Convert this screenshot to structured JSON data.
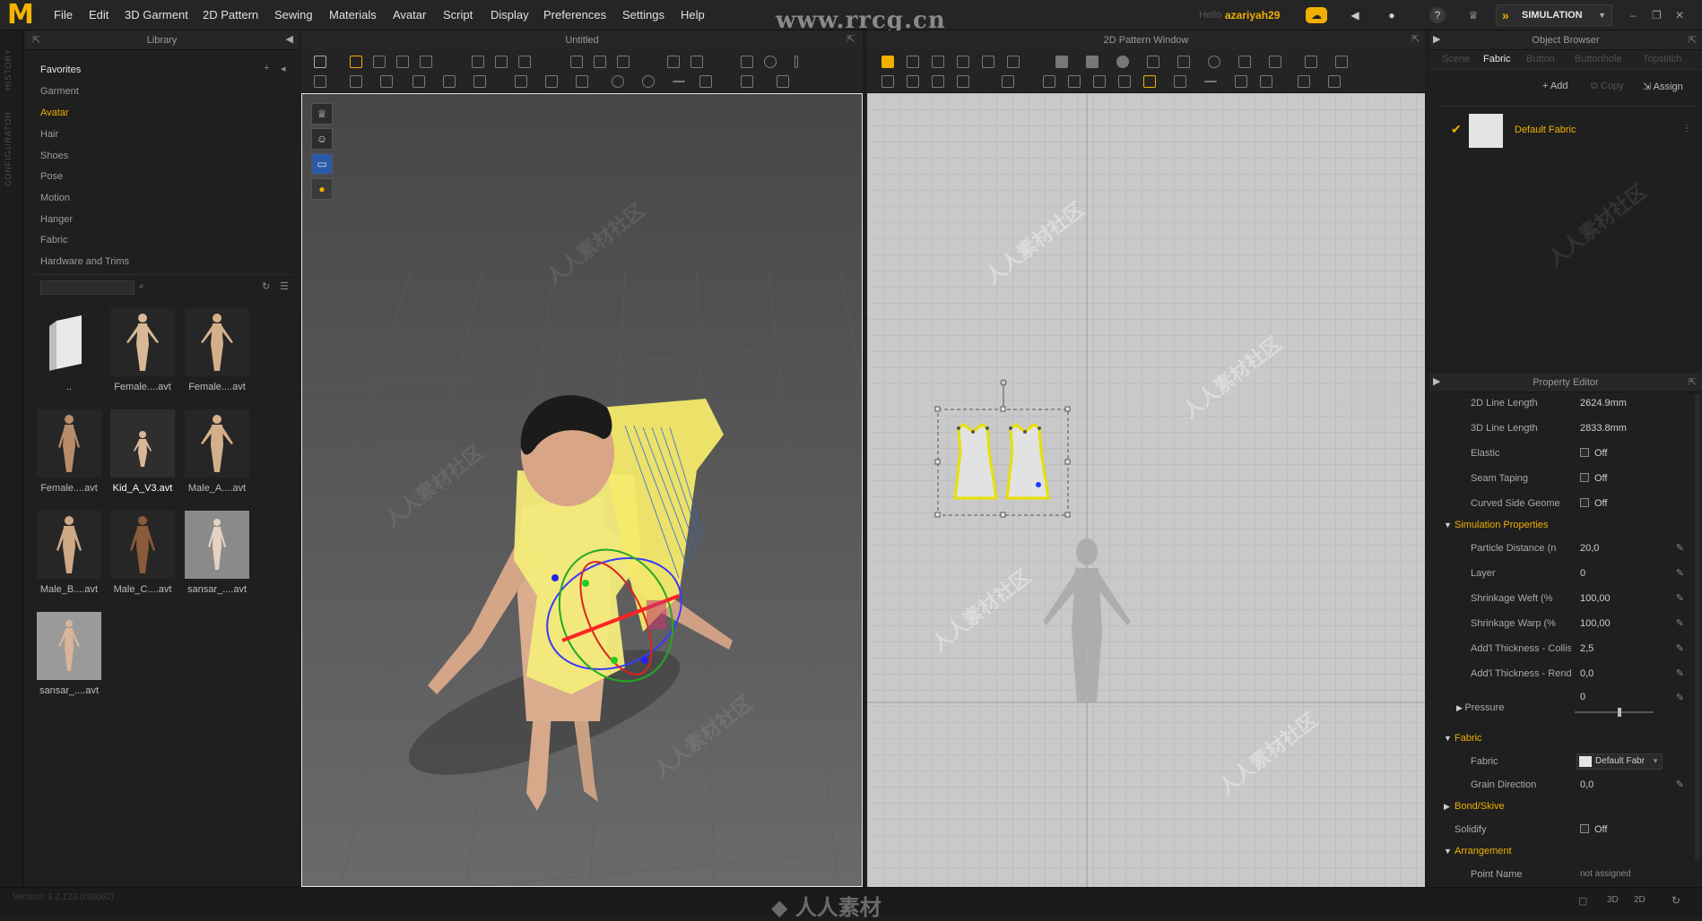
{
  "menubar": {
    "logo": "M",
    "items": [
      "File",
      "Edit",
      "3D Garment",
      "2D Pattern",
      "Sewing",
      "Materials",
      "Avatar",
      "Script",
      "Display",
      "Preferences",
      "Settings",
      "Help"
    ],
    "watermark": "www.rrcg.cn",
    "hello": "Hello",
    "username": "azariyah29",
    "mode": "SIMULATION"
  },
  "side_tabs": [
    "HISTORY",
    "CONFIGURATOR"
  ],
  "library": {
    "title": "Library",
    "favorites": "Favorites",
    "categories": [
      "Garment",
      "Avatar",
      "Hair",
      "Shoes",
      "Pose",
      "Motion",
      "Hanger",
      "Fabric",
      "Hardware and Trims"
    ],
    "active_category": "Avatar",
    "files": [
      "..",
      "Female....avt",
      "Female....avt",
      "Female....avt",
      "Kid_A_V3.avt",
      "Male_A....avt",
      "Male_B....avt",
      "Male_C....avt",
      "sansar_....avt",
      "sansar_....avt"
    ],
    "selected_file": "Kid_A_V3.avt"
  },
  "viewport3d": {
    "title": "Untitled"
  },
  "pattern2d": {
    "title": "2D Pattern Window"
  },
  "object_browser": {
    "title": "Object Browser",
    "tabs": [
      "Scene",
      "Fabric",
      "Button",
      "Buttonhole",
      "Topstitch"
    ],
    "active_tab": "Fabric",
    "add": "Add",
    "copy": "Copy",
    "assign": "Assign",
    "fabric_item": "Default Fabric"
  },
  "property_editor": {
    "title": "Property Editor",
    "rows_top": [
      {
        "name": "2D Line Length",
        "value": "2624.9mm"
      },
      {
        "name": "3D Line Length",
        "value": "2833.8mm"
      },
      {
        "name": "Elastic",
        "value": "Off"
      },
      {
        "name": "Seam Taping",
        "value": "Off"
      },
      {
        "name": "Curved Side Geome",
        "value": "Off"
      }
    ],
    "sim_section": "Simulation Properties",
    "rows_sim": [
      {
        "name": "Particle Distance (n",
        "value": "20,0"
      },
      {
        "name": "Layer",
        "value": "0"
      },
      {
        "name": "Shrinkage Weft (%",
        "value": "100,00"
      },
      {
        "name": "Shrinkage Warp (%",
        "value": "100,00"
      },
      {
        "name": "Add'l Thickness - Collisic",
        "value": "2,5"
      },
      {
        "name": "Add'l Thickness - Render",
        "value": "0,0"
      }
    ],
    "pressure": {
      "name": "Pressure",
      "value": "0"
    },
    "fabric_section": "Fabric",
    "fabric_row": {
      "name": "Fabric",
      "value": "Default Fabr"
    },
    "grain_row": {
      "name": "Grain Direction",
      "value": "0,0"
    },
    "bond_section": "Bond/Skive",
    "solidify": {
      "name": "Solidify",
      "value": "Off"
    },
    "arrangement_section": "Arrangement",
    "point_name": {
      "name": "Point Name",
      "value": "not assigned"
    }
  },
  "status": {
    "version": "Version: 3.2.123    (r30062)"
  },
  "colors": {
    "accent": "#f0b000",
    "garment": "#f3ea7a",
    "pattern_outline": "#e8e000"
  }
}
